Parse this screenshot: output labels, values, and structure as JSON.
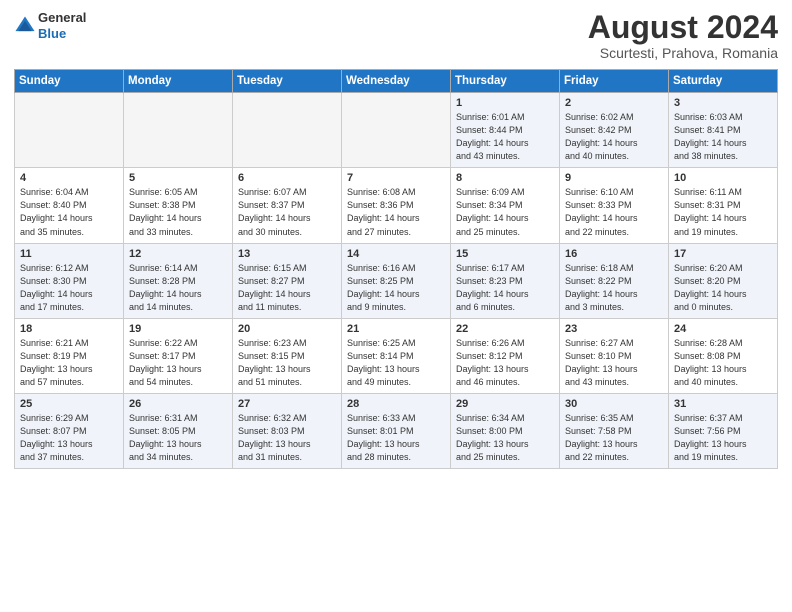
{
  "header": {
    "logo_line1": "General",
    "logo_line2": "Blue",
    "month_year": "August 2024",
    "location": "Scurtesti, Prahova, Romania"
  },
  "weekdays": [
    "Sunday",
    "Monday",
    "Tuesday",
    "Wednesday",
    "Thursday",
    "Friday",
    "Saturday"
  ],
  "weeks": [
    [
      {
        "day": "",
        "info": "",
        "empty": true
      },
      {
        "day": "",
        "info": "",
        "empty": true
      },
      {
        "day": "",
        "info": "",
        "empty": true
      },
      {
        "day": "",
        "info": "",
        "empty": true
      },
      {
        "day": "1",
        "info": "Sunrise: 6:01 AM\nSunset: 8:44 PM\nDaylight: 14 hours\nand 43 minutes."
      },
      {
        "day": "2",
        "info": "Sunrise: 6:02 AM\nSunset: 8:42 PM\nDaylight: 14 hours\nand 40 minutes."
      },
      {
        "day": "3",
        "info": "Sunrise: 6:03 AM\nSunset: 8:41 PM\nDaylight: 14 hours\nand 38 minutes."
      }
    ],
    [
      {
        "day": "4",
        "info": "Sunrise: 6:04 AM\nSunset: 8:40 PM\nDaylight: 14 hours\nand 35 minutes."
      },
      {
        "day": "5",
        "info": "Sunrise: 6:05 AM\nSunset: 8:38 PM\nDaylight: 14 hours\nand 33 minutes."
      },
      {
        "day": "6",
        "info": "Sunrise: 6:07 AM\nSunset: 8:37 PM\nDaylight: 14 hours\nand 30 minutes."
      },
      {
        "day": "7",
        "info": "Sunrise: 6:08 AM\nSunset: 8:36 PM\nDaylight: 14 hours\nand 27 minutes."
      },
      {
        "day": "8",
        "info": "Sunrise: 6:09 AM\nSunset: 8:34 PM\nDaylight: 14 hours\nand 25 minutes."
      },
      {
        "day": "9",
        "info": "Sunrise: 6:10 AM\nSunset: 8:33 PM\nDaylight: 14 hours\nand 22 minutes."
      },
      {
        "day": "10",
        "info": "Sunrise: 6:11 AM\nSunset: 8:31 PM\nDaylight: 14 hours\nand 19 minutes."
      }
    ],
    [
      {
        "day": "11",
        "info": "Sunrise: 6:12 AM\nSunset: 8:30 PM\nDaylight: 14 hours\nand 17 minutes."
      },
      {
        "day": "12",
        "info": "Sunrise: 6:14 AM\nSunset: 8:28 PM\nDaylight: 14 hours\nand 14 minutes."
      },
      {
        "day": "13",
        "info": "Sunrise: 6:15 AM\nSunset: 8:27 PM\nDaylight: 14 hours\nand 11 minutes."
      },
      {
        "day": "14",
        "info": "Sunrise: 6:16 AM\nSunset: 8:25 PM\nDaylight: 14 hours\nand 9 minutes."
      },
      {
        "day": "15",
        "info": "Sunrise: 6:17 AM\nSunset: 8:23 PM\nDaylight: 14 hours\nand 6 minutes."
      },
      {
        "day": "16",
        "info": "Sunrise: 6:18 AM\nSunset: 8:22 PM\nDaylight: 14 hours\nand 3 minutes."
      },
      {
        "day": "17",
        "info": "Sunrise: 6:20 AM\nSunset: 8:20 PM\nDaylight: 14 hours\nand 0 minutes."
      }
    ],
    [
      {
        "day": "18",
        "info": "Sunrise: 6:21 AM\nSunset: 8:19 PM\nDaylight: 13 hours\nand 57 minutes."
      },
      {
        "day": "19",
        "info": "Sunrise: 6:22 AM\nSunset: 8:17 PM\nDaylight: 13 hours\nand 54 minutes."
      },
      {
        "day": "20",
        "info": "Sunrise: 6:23 AM\nSunset: 8:15 PM\nDaylight: 13 hours\nand 51 minutes."
      },
      {
        "day": "21",
        "info": "Sunrise: 6:25 AM\nSunset: 8:14 PM\nDaylight: 13 hours\nand 49 minutes."
      },
      {
        "day": "22",
        "info": "Sunrise: 6:26 AM\nSunset: 8:12 PM\nDaylight: 13 hours\nand 46 minutes."
      },
      {
        "day": "23",
        "info": "Sunrise: 6:27 AM\nSunset: 8:10 PM\nDaylight: 13 hours\nand 43 minutes."
      },
      {
        "day": "24",
        "info": "Sunrise: 6:28 AM\nSunset: 8:08 PM\nDaylight: 13 hours\nand 40 minutes."
      }
    ],
    [
      {
        "day": "25",
        "info": "Sunrise: 6:29 AM\nSunset: 8:07 PM\nDaylight: 13 hours\nand 37 minutes."
      },
      {
        "day": "26",
        "info": "Sunrise: 6:31 AM\nSunset: 8:05 PM\nDaylight: 13 hours\nand 34 minutes."
      },
      {
        "day": "27",
        "info": "Sunrise: 6:32 AM\nSunset: 8:03 PM\nDaylight: 13 hours\nand 31 minutes."
      },
      {
        "day": "28",
        "info": "Sunrise: 6:33 AM\nSunset: 8:01 PM\nDaylight: 13 hours\nand 28 minutes."
      },
      {
        "day": "29",
        "info": "Sunrise: 6:34 AM\nSunset: 8:00 PM\nDaylight: 13 hours\nand 25 minutes."
      },
      {
        "day": "30",
        "info": "Sunrise: 6:35 AM\nSunset: 7:58 PM\nDaylight: 13 hours\nand 22 minutes."
      },
      {
        "day": "31",
        "info": "Sunrise: 6:37 AM\nSunset: 7:56 PM\nDaylight: 13 hours\nand 19 minutes."
      }
    ]
  ]
}
